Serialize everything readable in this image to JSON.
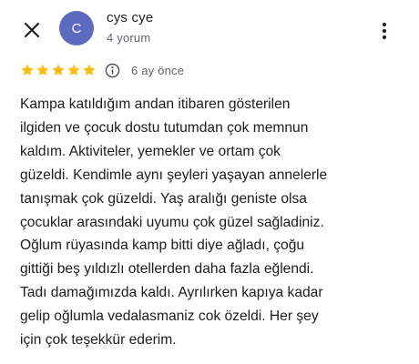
{
  "header": {
    "close_icon": "close-icon",
    "avatar_letter": "C",
    "avatar_color": "#5c6bc0",
    "user_name": "cys cye",
    "user_meta": "4 yorum",
    "more_icon": "more-vert-icon"
  },
  "review": {
    "rating": 5,
    "max_rating": 5,
    "star_color": "#fbbc04",
    "info_icon": "info-icon",
    "date": "6 ay önce",
    "text": "Kampa katıldığım andan itibaren gösterilen\nilgiden ve çocuk dostu tutumdan çok memnun\nkaldım. Aktiviteler, yemekler ve ortam çok\ngüzeldi. Kendimle aynı şeyleri yaşayan annelerle\ntanışmak çok güzeldi. Yaş aralığı geniste olsa\nçocuklar arasındaki uyumu çok güzel sağladiniz.\nOğlum rüyasında kamp bitti diye ağladı, çoğu\ngittiği beş yıldızlı otellerden daha fazla eğlendi.\nTadı damağımızda kaldı. Ayrılırken kapıya kadar\ngelip oğlumla vedalasmaniz cok özeldi. Her şey\niçin çok teşekkür ederim."
  }
}
